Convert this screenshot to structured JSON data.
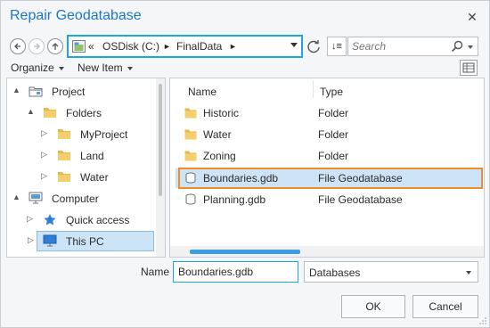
{
  "window": {
    "title": "Repair Geodatabase",
    "close_glyph": "✕"
  },
  "nav": {
    "back_icon": "back-arrow-icon",
    "forward_icon": "forward-arrow-icon",
    "up_icon": "up-arrow-icon",
    "address": {
      "overflow": "«",
      "segments": [
        "OSDisk (C:)",
        "FinalData"
      ],
      "separator": "►"
    },
    "sort_label": "↓≡",
    "search_placeholder": "Search"
  },
  "toolbar": {
    "organize": "Organize",
    "new_item": "New Item"
  },
  "tree": [
    {
      "label": "Project",
      "icon": "project-icon",
      "expander": "▲"
    },
    {
      "label": "Folders",
      "icon": "folder-icon",
      "expander": "▲"
    },
    {
      "label": "MyProject",
      "icon": "folder-icon",
      "expander": "▷"
    },
    {
      "label": "Land",
      "icon": "folder-icon",
      "expander": "▷"
    },
    {
      "label": "Water",
      "icon": "folder-icon",
      "expander": "▷"
    },
    {
      "label": "Computer",
      "icon": "computer-icon",
      "expander": "▲"
    },
    {
      "label": "Quick access",
      "icon": "star-icon",
      "expander": "▷"
    },
    {
      "label": "This PC",
      "icon": "monitor-icon",
      "expander": "▷",
      "selected": true
    }
  ],
  "columns": {
    "name": "Name",
    "type": "Type"
  },
  "files": [
    {
      "name": "Historic",
      "type": "Folder",
      "icon": "folder-icon"
    },
    {
      "name": "Water",
      "type": "Folder",
      "icon": "folder-icon"
    },
    {
      "name": "Zoning",
      "type": "Folder",
      "icon": "folder-icon"
    },
    {
      "name": "Boundaries.gdb",
      "type": "File Geodatabase",
      "icon": "geodatabase-icon",
      "selected": true
    },
    {
      "name": "Planning.gdb",
      "type": "File Geodatabase",
      "icon": "geodatabase-icon"
    }
  ],
  "bottom": {
    "name_label": "Name",
    "name_value": "Boundaries.gdb",
    "type_filter": "Databases",
    "ok": "OK",
    "cancel": "Cancel"
  },
  "colors": {
    "accent": "#1ca7df",
    "title": "#1b76c9",
    "highlight": "#f58a2a",
    "selection": "#cde4f7",
    "folder": "#e8b84a"
  }
}
